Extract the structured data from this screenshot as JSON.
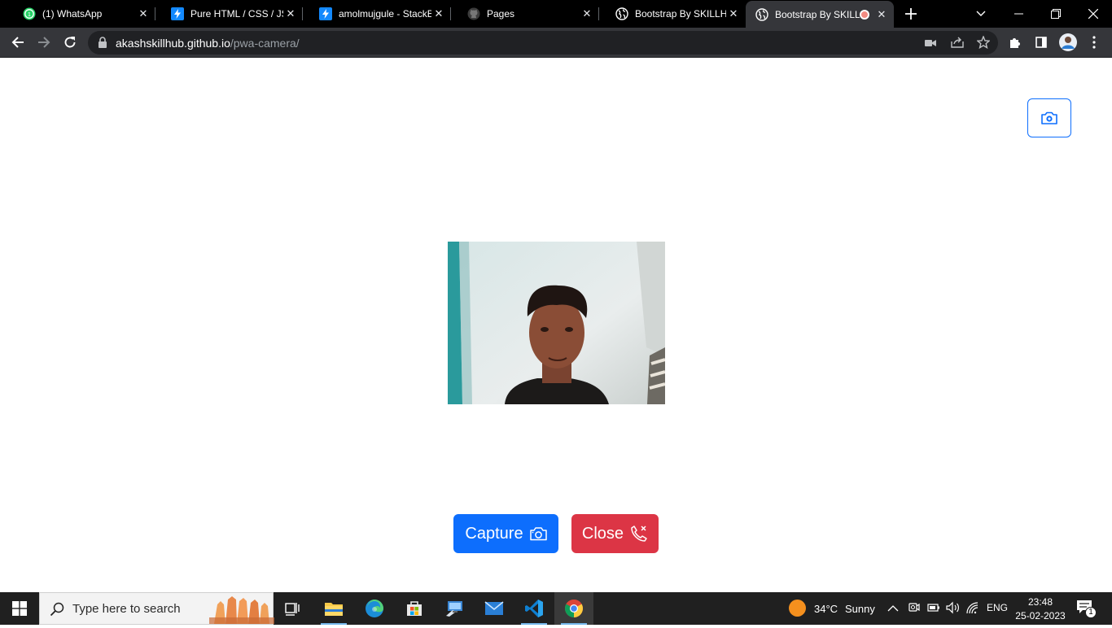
{
  "browser": {
    "tabs": [
      {
        "title": "(1) WhatsApp",
        "icon": "whatsapp-icon",
        "active": false
      },
      {
        "title": "Pure HTML / CSS / JS (",
        "icon": "stackblitz-icon",
        "active": false
      },
      {
        "title": "amolmujgule - StackBl",
        "icon": "stackblitz-icon",
        "active": false
      },
      {
        "title": "Pages",
        "icon": "github-icon",
        "active": false
      },
      {
        "title": "Bootstrap By SKILLHUB",
        "icon": "globe-icon",
        "active": false
      },
      {
        "title": "Bootstrap By SKILL",
        "icon": "globe-icon",
        "active": true,
        "recording": true
      }
    ],
    "url_host": "akashskillhub.github.io",
    "url_path": "/pwa-camera/"
  },
  "page": {
    "capture_label": "Capture",
    "close_label": "Close"
  },
  "taskbar": {
    "search_placeholder": "Type here to search",
    "weather_temp": "34°C",
    "weather_text": "Sunny",
    "language": "ENG",
    "time": "23:48",
    "date": "25-02-2023",
    "notification_count": "1"
  },
  "colors": {
    "primary": "#0d6efd",
    "danger": "#dc3545",
    "chrome_dark": "#35363a",
    "taskbar": "#202020"
  }
}
